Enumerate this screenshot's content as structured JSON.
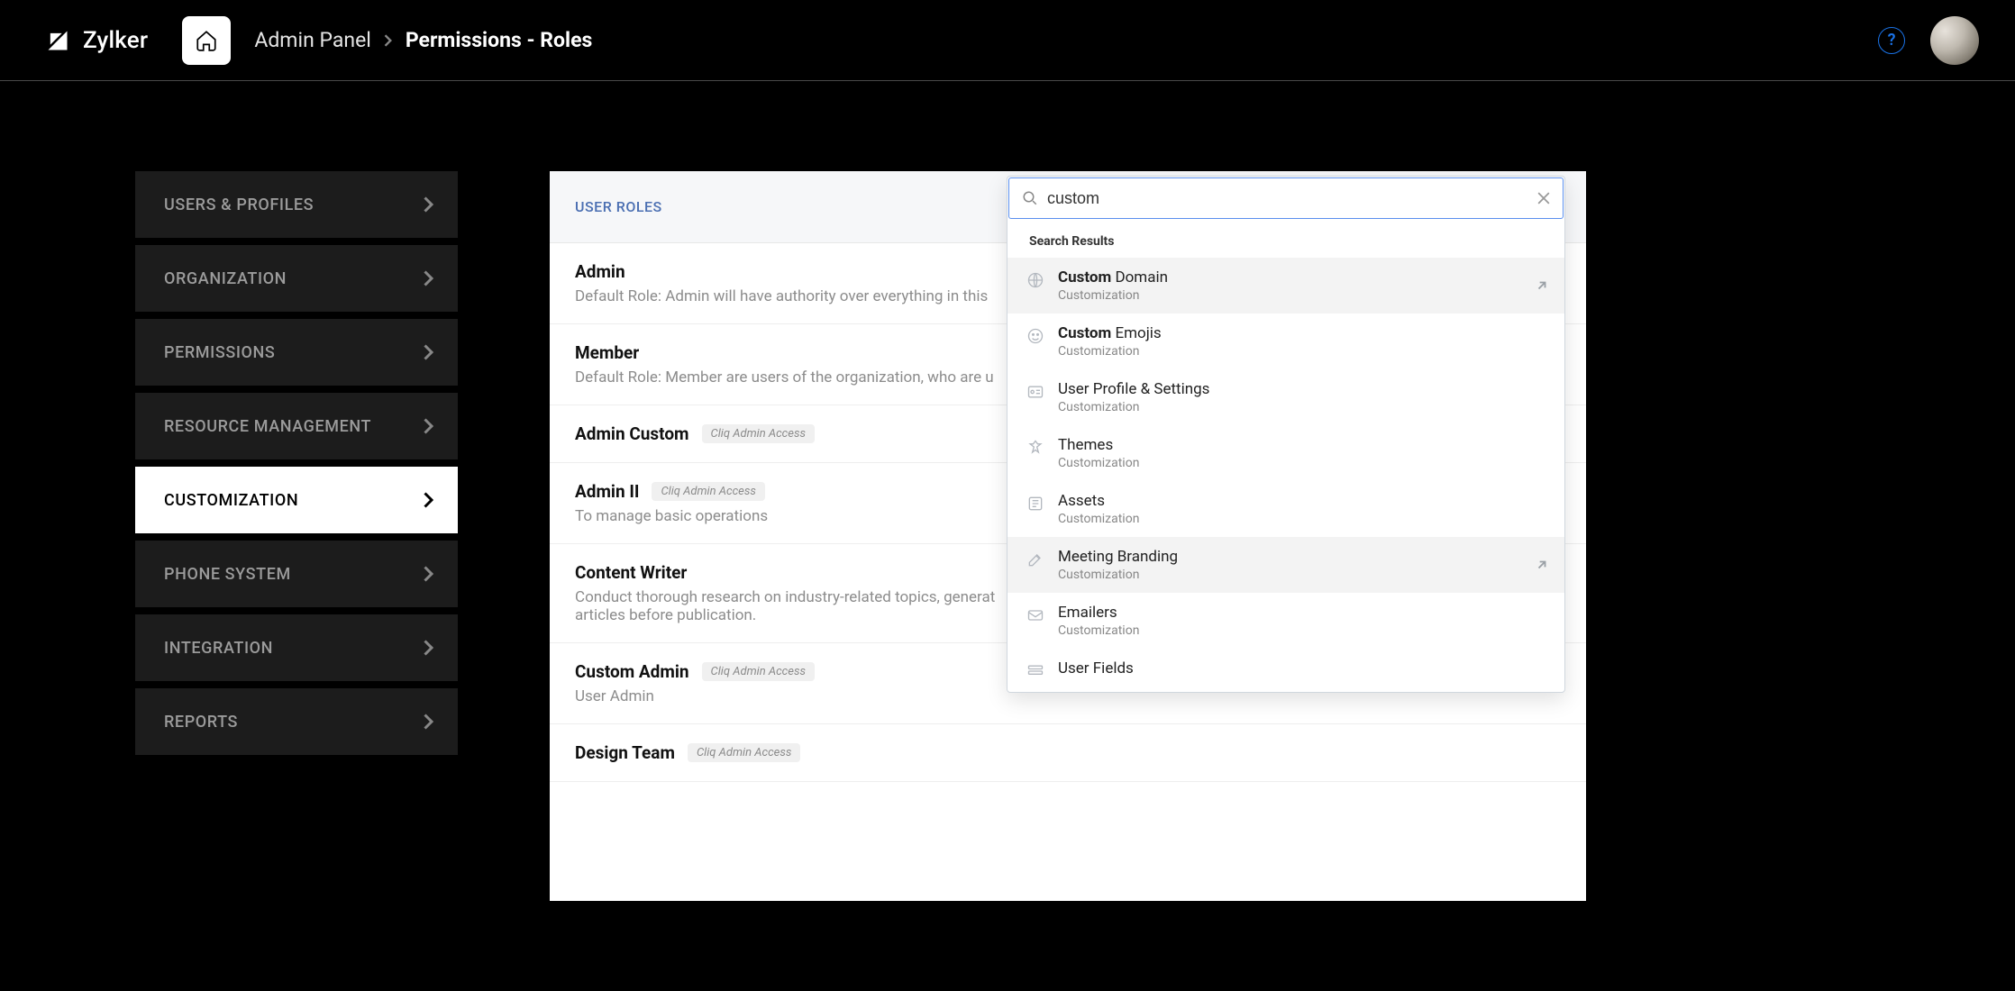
{
  "brand": {
    "name": "Zylker"
  },
  "breadcrumb": {
    "parent": "Admin Panel",
    "current": "Permissions - Roles"
  },
  "sidebar": {
    "items": [
      {
        "label": "USERS & PROFILES"
      },
      {
        "label": "ORGANIZATION"
      },
      {
        "label": "PERMISSIONS"
      },
      {
        "label": "RESOURCE MANAGEMENT"
      },
      {
        "label": "CUSTOMIZATION"
      },
      {
        "label": "PHONE SYSTEM"
      },
      {
        "label": "INTEGRATION"
      },
      {
        "label": "REPORTS"
      }
    ],
    "active_index": 4
  },
  "panel": {
    "section_title": "USER ROLES",
    "roles": [
      {
        "name": "Admin",
        "desc": "Default Role: Admin will have authority over everything in this",
        "badge": null
      },
      {
        "name": "Member",
        "desc": "Default Role: Member are users of the organization, who are u",
        "badge": null
      },
      {
        "name": "Admin Custom",
        "desc": null,
        "badge": "Cliq Admin Access"
      },
      {
        "name": "Admin II",
        "desc": "To manage basic operations",
        "badge": "Cliq Admin Access"
      },
      {
        "name": "Content Writer",
        "desc": "Conduct thorough research on industry-related topics, generat\narticles before publication.",
        "badge": null
      },
      {
        "name": "Custom Admin",
        "desc": "User Admin",
        "badge": "Cliq Admin Access"
      },
      {
        "name": "Design Team",
        "desc": null,
        "badge": "Cliq Admin Access"
      }
    ]
  },
  "search": {
    "value": "custom",
    "results_header": "Search Results",
    "results": [
      {
        "title_prefix": "Custom",
        "title_rest": " Domain",
        "sub_prefix": "Custom",
        "sub_rest": "ization",
        "icon": "globe",
        "highlighted": true,
        "has_goto": true
      },
      {
        "title_prefix": "Custom",
        "title_rest": " Emojis",
        "sub_prefix": "Custom",
        "sub_rest": "ization",
        "icon": "emoji",
        "highlighted": false,
        "has_goto": false
      },
      {
        "title_prefix": "",
        "title_rest": "User Profile & Settings",
        "sub_prefix": "Custom",
        "sub_rest": "ization",
        "icon": "card",
        "highlighted": false,
        "has_goto": false
      },
      {
        "title_prefix": "",
        "title_rest": "Themes",
        "sub_prefix": "Custom",
        "sub_rest": "ization",
        "icon": "theme",
        "highlighted": false,
        "has_goto": false
      },
      {
        "title_prefix": "",
        "title_rest": "Assets",
        "sub_prefix": "Custom",
        "sub_rest": "ization",
        "icon": "asset",
        "highlighted": false,
        "has_goto": false
      },
      {
        "title_prefix": "",
        "title_rest": "Meeting Branding",
        "sub_prefix": "Custom",
        "sub_rest": "ization",
        "icon": "edit",
        "highlighted": true,
        "has_goto": true
      },
      {
        "title_prefix": "",
        "title_rest": "Emailers",
        "sub_prefix": "Custom",
        "sub_rest": "ization",
        "icon": "mail",
        "highlighted": false,
        "has_goto": false
      },
      {
        "title_prefix": "",
        "title_rest": "User Fields",
        "sub_prefix": "",
        "sub_rest": "",
        "icon": "fields",
        "highlighted": false,
        "has_goto": false
      }
    ]
  }
}
